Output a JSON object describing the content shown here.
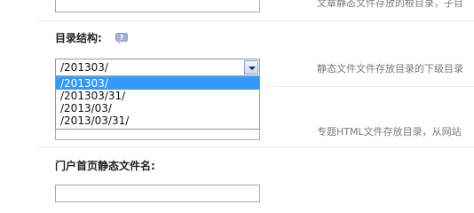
{
  "top_row": {
    "hint": "文章静态文件存放的根目录，子目"
  },
  "dir_structure": {
    "label": "目录结构:",
    "help_icon": "help-bubble-icon",
    "select_value": "/201303/",
    "hint": "静态文件文件存放目录的下级目录",
    "options": [
      {
        "label": "/201303/",
        "selected": true
      },
      {
        "label": "/201303/31/",
        "selected": false
      },
      {
        "label": "/2013/03/",
        "selected": false
      },
      {
        "label": "/2013/03/31/",
        "selected": false
      }
    ]
  },
  "topic_row": {
    "hint": "专题HTML文件存放目录，从网站"
  },
  "portal_row": {
    "label": "门户首页静态文件名:"
  },
  "colors": {
    "selected_option": "#3399ff",
    "border": "#a9a9a9",
    "select_border": "#7f9db9"
  }
}
